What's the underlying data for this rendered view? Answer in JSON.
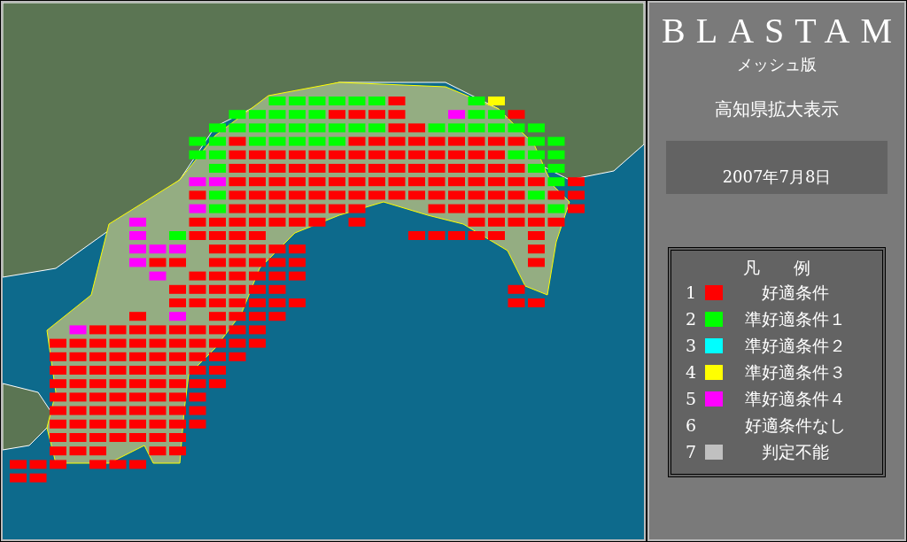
{
  "header": {
    "title": "BLASTAM",
    "subtitle": "メッシュ版",
    "view": "高知県拡大表示",
    "date": "2007年7月8日"
  },
  "legend": {
    "title": "凡　　例",
    "items": [
      {
        "number": "1",
        "label": "好適条件",
        "color": "#ff0000"
      },
      {
        "number": "2",
        "label": "準好適条件１",
        "color": "#00ff00"
      },
      {
        "number": "3",
        "label": "準好適条件２",
        "color": "#00ffff"
      },
      {
        "number": "4",
        "label": "準好適条件３",
        "color": "#ffff00"
      },
      {
        "number": "5",
        "label": "準好適条件４",
        "color": "#ff00ff"
      },
      {
        "number": "6",
        "label": "好適条件なし"
      },
      {
        "number": "7",
        "label": "判定不能",
        "color": "#c0c0c0"
      }
    ]
  }
}
